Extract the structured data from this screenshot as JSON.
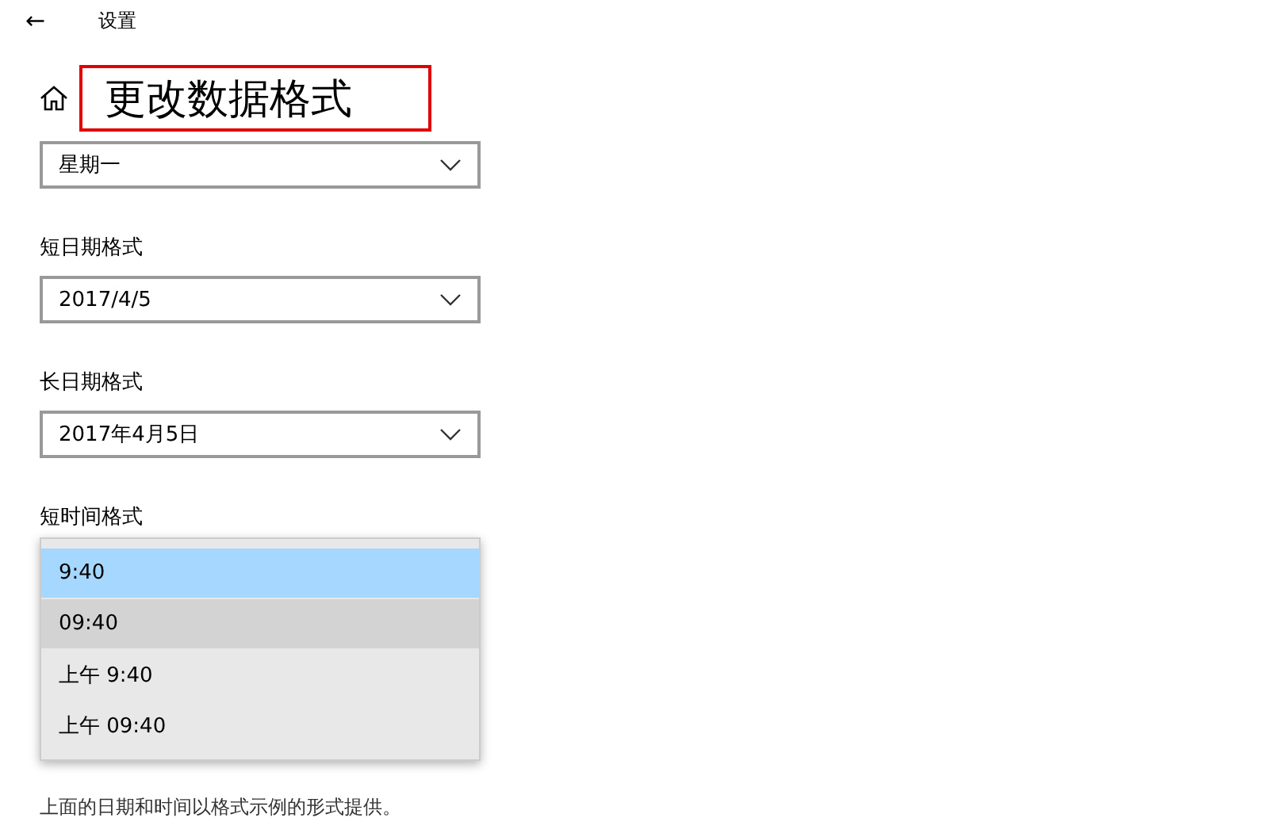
{
  "header": {
    "back": "←",
    "title": "设置"
  },
  "page": {
    "title": "更改数据格式",
    "highlighted": true
  },
  "fields": [
    {
      "value": "星期一"
    },
    {
      "label": "短日期格式",
      "value": "2017/4/5"
    },
    {
      "label": "长日期格式",
      "value": "2017年4月5日"
    }
  ],
  "short_time": {
    "label": "短时间格式",
    "options": [
      {
        "text": "9:40",
        "selected": true,
        "hovered": false
      },
      {
        "text": "09:40",
        "selected": false,
        "hovered": true
      },
      {
        "text": "上午 9:40",
        "selected": false,
        "hovered": false
      },
      {
        "text": "上午 09:40",
        "selected": false,
        "hovered": false
      }
    ]
  },
  "footnote": "上面的日期和时间以格式示例的形式提供。"
}
